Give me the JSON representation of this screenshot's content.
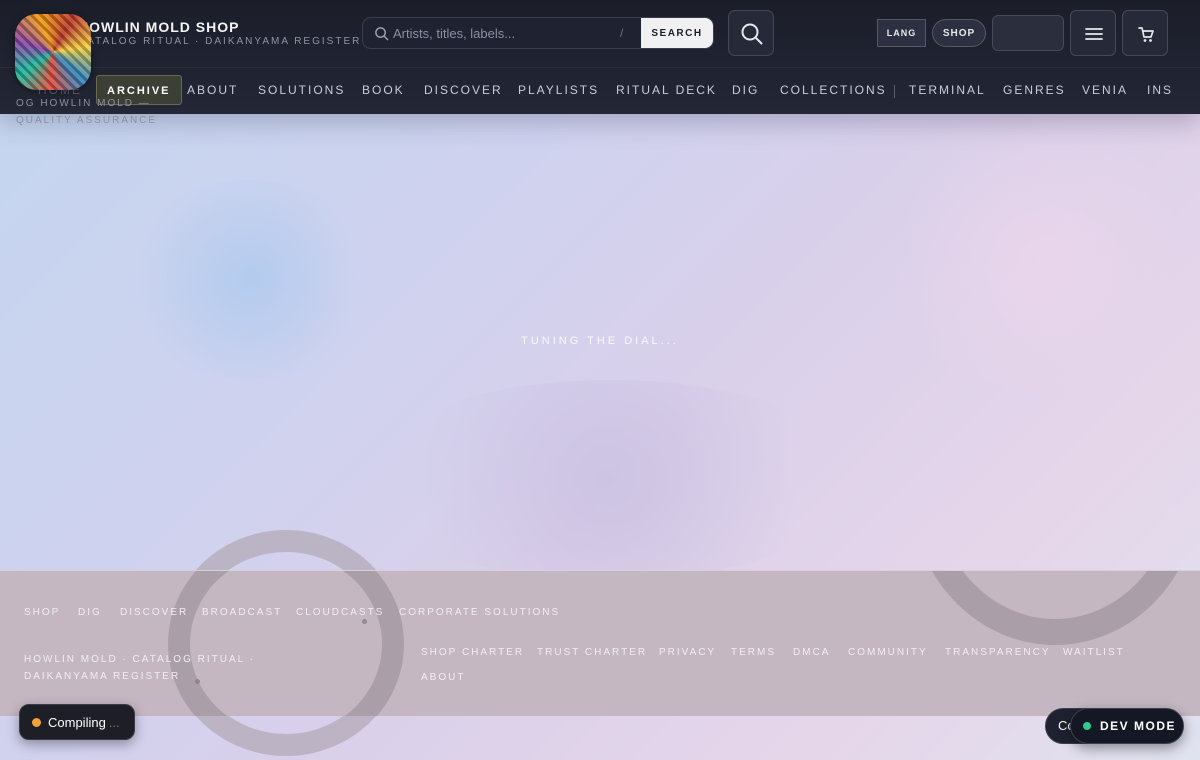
{
  "brand": {
    "title": "HOWLIN MOLD SHOP",
    "subtitle": "CATALOG RITUAL · DAIKANYAMA REGISTER",
    "logo_icon": "album-art-collage"
  },
  "search": {
    "placeholder": "Artists, titles, labels...",
    "shortcut": "/",
    "button_label": "SEARCH"
  },
  "header_actions": {
    "lang_label": "LANG",
    "shop_label": "SHOP",
    "blank_button_label": "",
    "menu_icon": "hamburger-icon",
    "cart_icon": "cart-icon",
    "search_icon": "search-icon"
  },
  "nav": {
    "items": [
      {
        "label": "HOME",
        "state": "faded"
      },
      {
        "label": "ARCHIVE",
        "state": "active"
      },
      {
        "label": "ABOUT",
        "state": "normal"
      },
      {
        "label": "SOLUTIONS",
        "state": "normal"
      },
      {
        "label": "BOOK",
        "state": "normal"
      },
      {
        "label": "DISCOVER",
        "state": "normal"
      },
      {
        "label": "PLAYLISTS",
        "state": "normal"
      },
      {
        "label": "RITUAL DECK",
        "state": "normal"
      },
      {
        "label": "DIG",
        "state": "normal"
      },
      {
        "label": "COLLECTIONS",
        "state": "normal"
      },
      {
        "label": "TERMINAL",
        "state": "normal"
      },
      {
        "label": "GENRES",
        "state": "normal"
      },
      {
        "label": "VENIA",
        "state": "normal"
      },
      {
        "label": "INS",
        "state": "normal"
      }
    ]
  },
  "qa_label": "OG HOWLIN MOLD — QUALITY ASSURANCE",
  "loading_text": "TUNING THE DIAL...",
  "footer": {
    "top_links": [
      "SHOP",
      "DIG",
      "DISCOVER",
      "BROADCAST",
      "CLOUDCASTS",
      "CORPORATE SOLUTIONS"
    ],
    "brand_text": "HOWLIN MOLD · CATALOG RITUAL · DAIKANYAMA REGISTER",
    "legal_links": [
      "SHOP CHARTER",
      "TRUST CHARTER",
      "PRIVACY",
      "TERMS",
      "DMCA",
      "COMMUNITY",
      "TRANSPARENCY",
      "WAITLIST",
      "ABOUT"
    ]
  },
  "status": {
    "compiling_label": "Compiling",
    "compiling_suffix": "...",
    "co_label": "Co",
    "dev_mode_label": "DEV MODE"
  },
  "colors": {
    "header_bg": "#1b1e29",
    "footer_bg": "#c4b7c2",
    "compiling_dot": "#f0a434",
    "dev_mode_dot": "#2ecc8f"
  }
}
